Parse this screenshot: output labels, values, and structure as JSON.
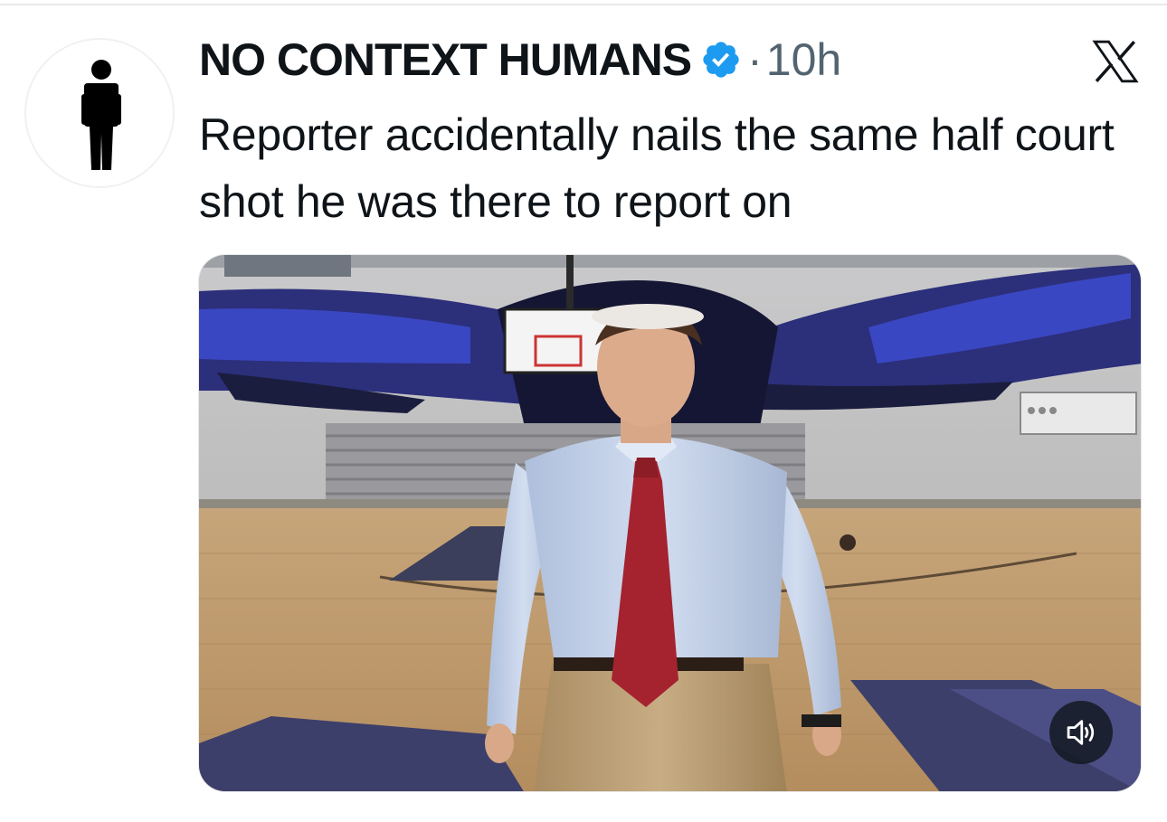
{
  "tweet": {
    "author": {
      "display_name": "NO CONTEXT HUMANS",
      "verified": true,
      "avatar_icon": "person-standing-icon"
    },
    "separator": "·",
    "timestamp": "10h",
    "platform_icon": "x-logo-icon",
    "text": "Reporter accidentally nails the same half court shot he was there to report on",
    "media": {
      "type": "video",
      "volume_icon": "speaker-icon"
    }
  },
  "colors": {
    "text_primary": "#0f1419",
    "text_secondary": "#536471",
    "verified_blue": "#1d9bf0",
    "divider": "#e7e9ea"
  }
}
